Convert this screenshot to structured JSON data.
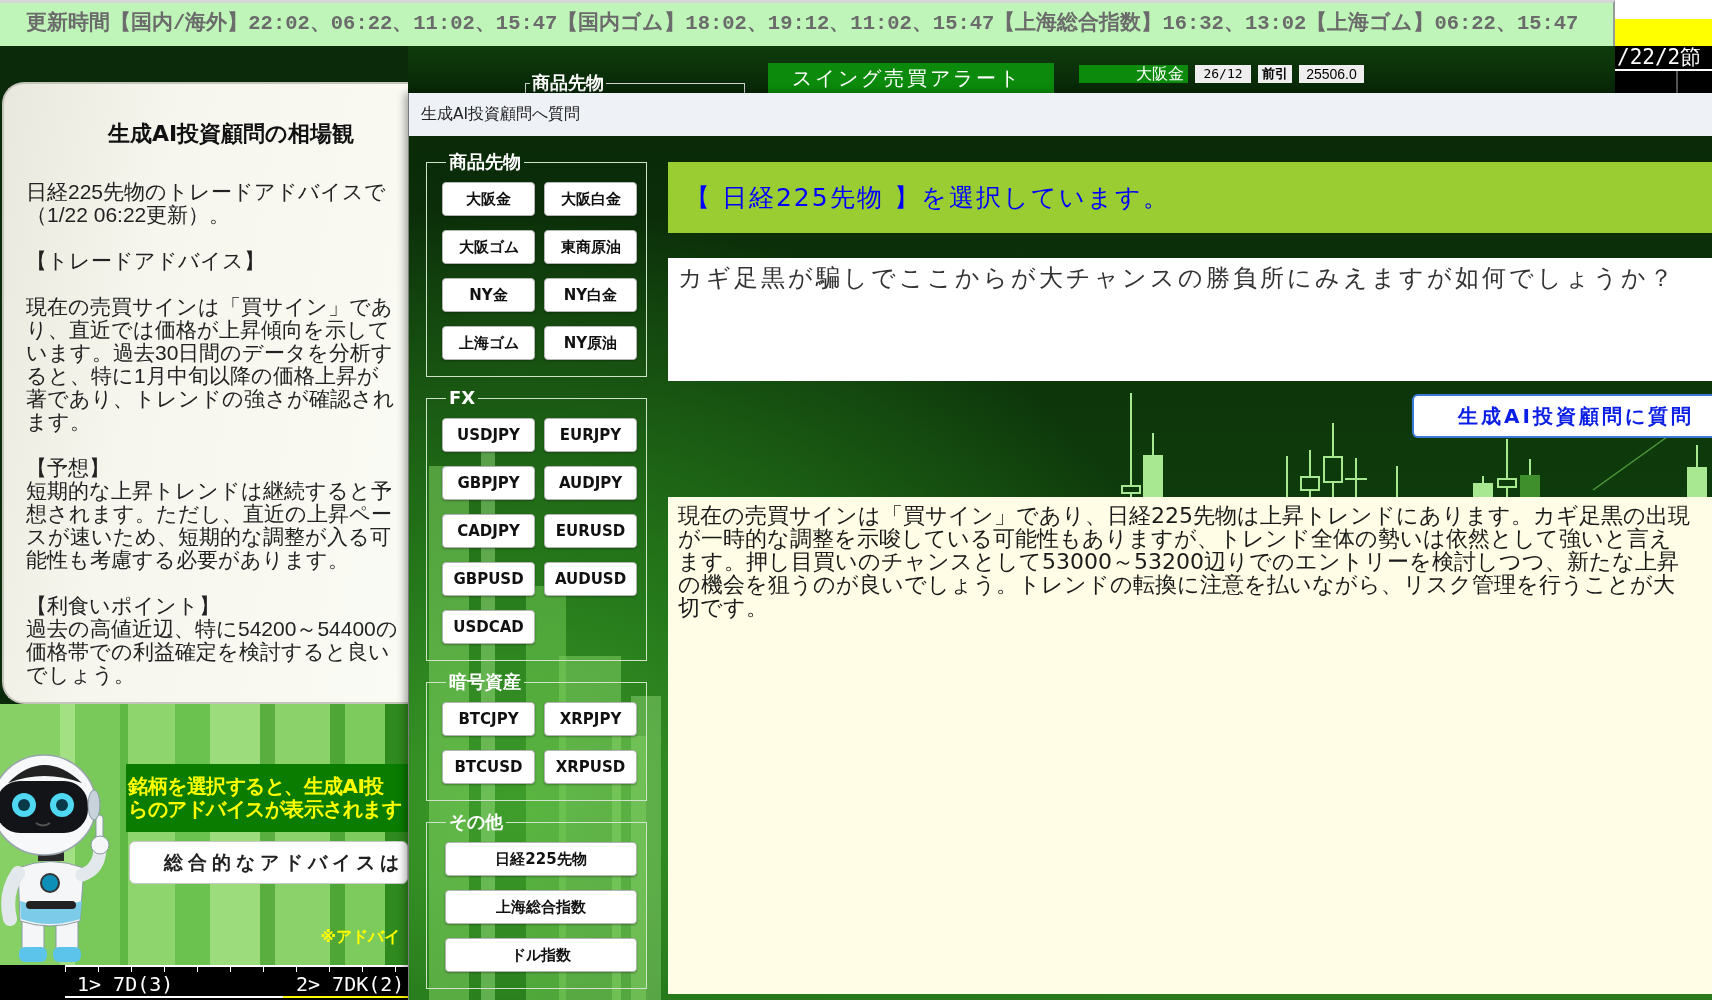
{
  "ticker_bar": {
    "text": "更新時間【国内/海外】22:02、06:22、11:02、15:47【国内ゴム】18:02、19:12、11:02、15:47【上海総合指数】16:32、13:02【上海ゴム】06:22、15:47"
  },
  "header_strip": {
    "section_label": "商品先物",
    "alert_button": "スイング売買アラート",
    "quote": {
      "symbol": "大阪金",
      "contract_month": "26/12",
      "session": "前引",
      "price": "25506.0"
    },
    "date_text": "/22/2節"
  },
  "advisor_bubble": {
    "title": "生成AI投資顧問の相場観",
    "paragraphs": [
      [
        "日経225先物のトレードアドバイスで",
        "（1/22 06:22更新）。"
      ],
      [
        "【トレードアドバイス】"
      ],
      [
        "現在の売買サインは「買サイン」であ",
        "り、直近では価格が上昇傾向を示して",
        "います。過去30日間のデータを分析す",
        "ると、特に1月中旬以降の価格上昇が",
        "著であり、トレンドの強さが確認され",
        "ます。"
      ],
      [
        "【予想】",
        "短期的な上昇トレンドは継続すると予",
        "想されます。ただし、直近の上昇ペー",
        "スが速いため、短期的な調整が入る可",
        "能性も考慮する必要があります。"
      ],
      [
        "【利食いポイント】",
        "過去の高値近辺、特に54200～54400の",
        "価格帯での利益確定を検討すると良い",
        "でしょう。"
      ]
    ]
  },
  "guide_panel": {
    "notice_lines": [
      "銘柄を選択すると、生成AI投",
      "らのアドバイスが表示されます"
    ],
    "advice_button": "総合的なアドバイスは",
    "footnote": "※アドバイ",
    "indicators": [
      {
        "label": "1> 7D(3)",
        "color": "#ffffff"
      },
      {
        "label": "2> 7DK(2)",
        "color": "#ffff00"
      }
    ]
  },
  "dialog": {
    "title": "生成AI投資顧問へ質問",
    "groups": [
      {
        "label": "商品先物",
        "kind": "grid",
        "buttons": [
          "大阪金",
          "大阪白金",
          "大阪ゴム",
          "東商原油",
          "NY金",
          "NY白金",
          "上海ゴム",
          "NY原油"
        ]
      },
      {
        "label": "FX",
        "kind": "grid",
        "buttons": [
          "USDJPY",
          "EURJPY",
          "GBPJPY",
          "AUDJPY",
          "CADJPY",
          "EURUSD",
          "GBPUSD",
          "AUDUSD",
          "USDCAD"
        ]
      },
      {
        "label": "暗号資産",
        "kind": "grid",
        "buttons": [
          "BTCJPY",
          "XRPJPY",
          "BTCUSD",
          "XRPUSD"
        ]
      },
      {
        "label": "その他",
        "kind": "stack",
        "buttons": [
          "日経225先物",
          "上海総合指数",
          "ドル指数"
        ]
      }
    ],
    "selection_banner": "【 日経225先物 】を選択しています。",
    "question": {
      "value": "カギ足黒が騙しでここからが大チャンスの勝負所にみえますが如何でしょうか？"
    },
    "ask_button": "生成AI投資顧問に質問",
    "answer": "現在の売買サインは「買サイン」であり、日経225先物は上昇トレンドにあります。カギ足黒の出現が一時的な調整を示唆している可能性もありますが、トレンド全体の勢いは依然として強いと言えます。押し目買いのチャンスとして53000～53200辺りでのエントリーを検討しつつ、新たな上昇の機会を狙うのが良いでしょう。トレンドの転換に注意を払いながら、リスク管理を行うことが大切です。"
  }
}
